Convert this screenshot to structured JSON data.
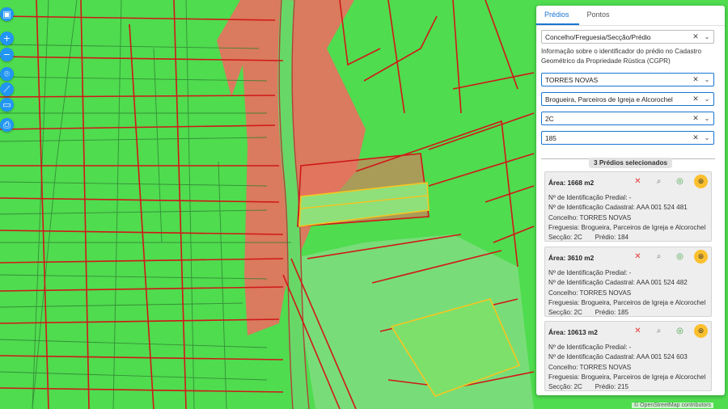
{
  "tabs": [
    {
      "label": "Prédios",
      "active": true
    },
    {
      "label": "Pontos",
      "active": false
    }
  ],
  "search_type": {
    "value": "Concelho/Freguesia/Secção/Prédio"
  },
  "info_text": "Informação sobre o identificador do prédio no Cadastro Geométrico da Propriedade Rústica (CGPR)",
  "filters": {
    "concelho": "TORRES NOVAS",
    "freguesia": "Brogueira, Parceiros de Igreja e Alcorochel",
    "seccao": "2C",
    "predio": "185"
  },
  "selection_label": "3 Prédios selecionados",
  "properties": [
    {
      "area": "Área: 1668 m2",
      "ident_predial": "Nº de Identificação Predial: -",
      "ident_cadastral": "Nº de Identificação Cadastral: AAA 001 524 481",
      "concelho": "Concelho: TORRES NOVAS",
      "freguesia": "Freguesia: Brogueira, Parceiros de Igreja e Alcorochel",
      "seccao": "Secção: 2C",
      "predio": "Prédio: 184"
    },
    {
      "area": "Área: 3610 m2",
      "ident_predial": "Nº de Identificação Predial: -",
      "ident_cadastral": "Nº de Identificação Cadastral: AAA 001 524 482",
      "concelho": "Concelho: TORRES NOVAS",
      "freguesia": "Freguesia: Brogueira, Parceiros de Igreja e Alcorochel",
      "seccao": "Secção: 2C",
      "predio": "Prédio: 185"
    },
    {
      "area": "Área: 10613 m2",
      "ident_predial": "Nº de Identificação Predial: -",
      "ident_cadastral": "Nº de Identificação Cadastral: AAA 001 524 603",
      "concelho": "Concelho: TORRES NOVAS",
      "freguesia": "Freguesia: Brogueira, Parceiros de Igreja e Alcorochel",
      "seccao": "Secção: 2C",
      "predio": "Prédio: 215"
    }
  ],
  "attribution": "© OpenStreetMap contributors",
  "map_tools": [
    "layers-icon",
    "zoom-in-icon",
    "zoom-out-icon",
    "pin-icon",
    "measure-icon",
    "image-icon",
    "print-icon"
  ],
  "colors": {
    "parcel_fill": "#4fdc4f",
    "parcel_line": "#d01818",
    "highlight_fill": "#ea6a55",
    "selected_outline": "#f7c520",
    "selected_fill": "#7ce06b",
    "accent": "#1976d2",
    "tool_button": "#2196f3"
  }
}
